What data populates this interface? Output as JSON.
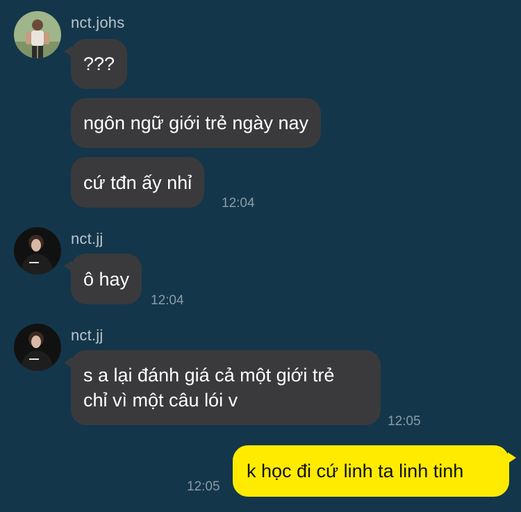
{
  "colors": {
    "background": "#13364A",
    "incoming_bubble": "#3A3A3C",
    "outgoing_bubble": "#FFEB00",
    "sender_name": "#B9C4CC",
    "timestamp": "#8C9BA6"
  },
  "messages": [
    {
      "sender": "nct.johs",
      "avatar_icon": "user-avatar-johs",
      "bubbles": [
        "???",
        "ngôn ngữ giới trẻ ngày nay",
        "cứ tđn ấy nhỉ"
      ],
      "time": "12:04"
    },
    {
      "sender": "nct.jj",
      "avatar_icon": "user-avatar-jj",
      "bubbles": [
        "ô hay"
      ],
      "time": "12:04"
    },
    {
      "sender": "nct.jj",
      "avatar_icon": "user-avatar-jj",
      "bubbles": [
        {
          "line1": "s a lại đánh giá cả một giới trẻ",
          "line2": "chỉ vì một câu lói v"
        }
      ],
      "time": "12:05"
    },
    {
      "sender": "me",
      "bubbles": [
        "k học đi cứ linh ta linh tinh"
      ],
      "time": "12:05"
    }
  ]
}
